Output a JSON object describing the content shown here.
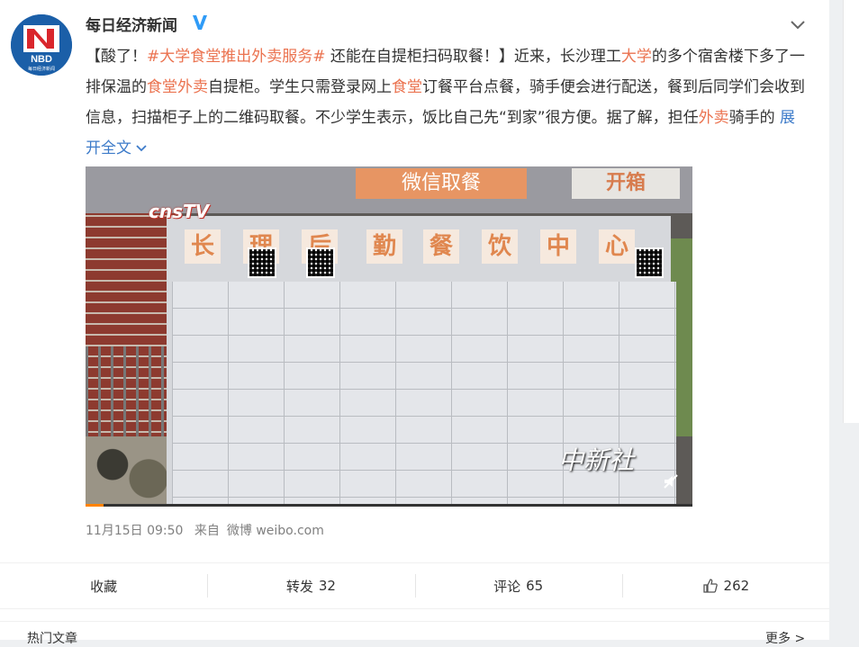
{
  "account": {
    "name": "每日经济新闻",
    "avatar_text": "NBD",
    "avatar_subtext": "每日经济新闻",
    "verified_icon": "verified-v-icon"
  },
  "post": {
    "segments": [
      {
        "t": "【酸了！",
        "c": "plain"
      },
      {
        "t": "#大学",
        "c": "tag"
      },
      {
        "t": "食堂",
        "c": "hl"
      },
      {
        "t": "推出",
        "c": "tag"
      },
      {
        "t": "外卖",
        "c": "hl"
      },
      {
        "t": "服务#",
        "c": "tag"
      },
      {
        "t": " 还能在自提柜扫码取餐！】近来，长沙理工",
        "c": "plain"
      },
      {
        "t": "大学",
        "c": "hl"
      },
      {
        "t": "的多个宿舍楼下多了一排保温的",
        "c": "plain"
      },
      {
        "t": "食堂外卖",
        "c": "hl"
      },
      {
        "t": "自提柜。学生只需登录网上",
        "c": "plain"
      },
      {
        "t": "食堂",
        "c": "hl"
      },
      {
        "t": "订餐平台点餐，骑手便会进行配送，餐到后同学们会收到信息，扫描柜子上的二维码取餐。不少学生表示，饭比自己先“到家”很方便。据了解，担任",
        "c": "plain"
      },
      {
        "t": "外卖",
        "c": "hl"
      },
      {
        "t": "骑手的 ",
        "c": "plain"
      }
    ],
    "expand_label": "展开全文"
  },
  "video": {
    "watermark_top": "cnsTV",
    "sign_wechat": "微信取餐",
    "sign_open": "开箱",
    "sign_chars": [
      "长",
      "理",
      "后",
      "勤",
      "餐",
      "饮",
      "中",
      "心"
    ],
    "watermark_bottom": "中新社",
    "progress": 0.03
  },
  "meta": {
    "time": "11月15日 09:50",
    "source_prefix": "来自",
    "source": "微博 weibo.com"
  },
  "actions": {
    "favorite": "收藏",
    "repost_label": "转发",
    "repost_count": "32",
    "comment_label": "评论",
    "comment_count": "65",
    "like_count": "262"
  },
  "bottom": {
    "label": "热门文章",
    "more": "更多 >"
  },
  "colors": {
    "highlight": "#eb7350",
    "link": "#3d7bc9",
    "verified": "#2f9bf7"
  }
}
